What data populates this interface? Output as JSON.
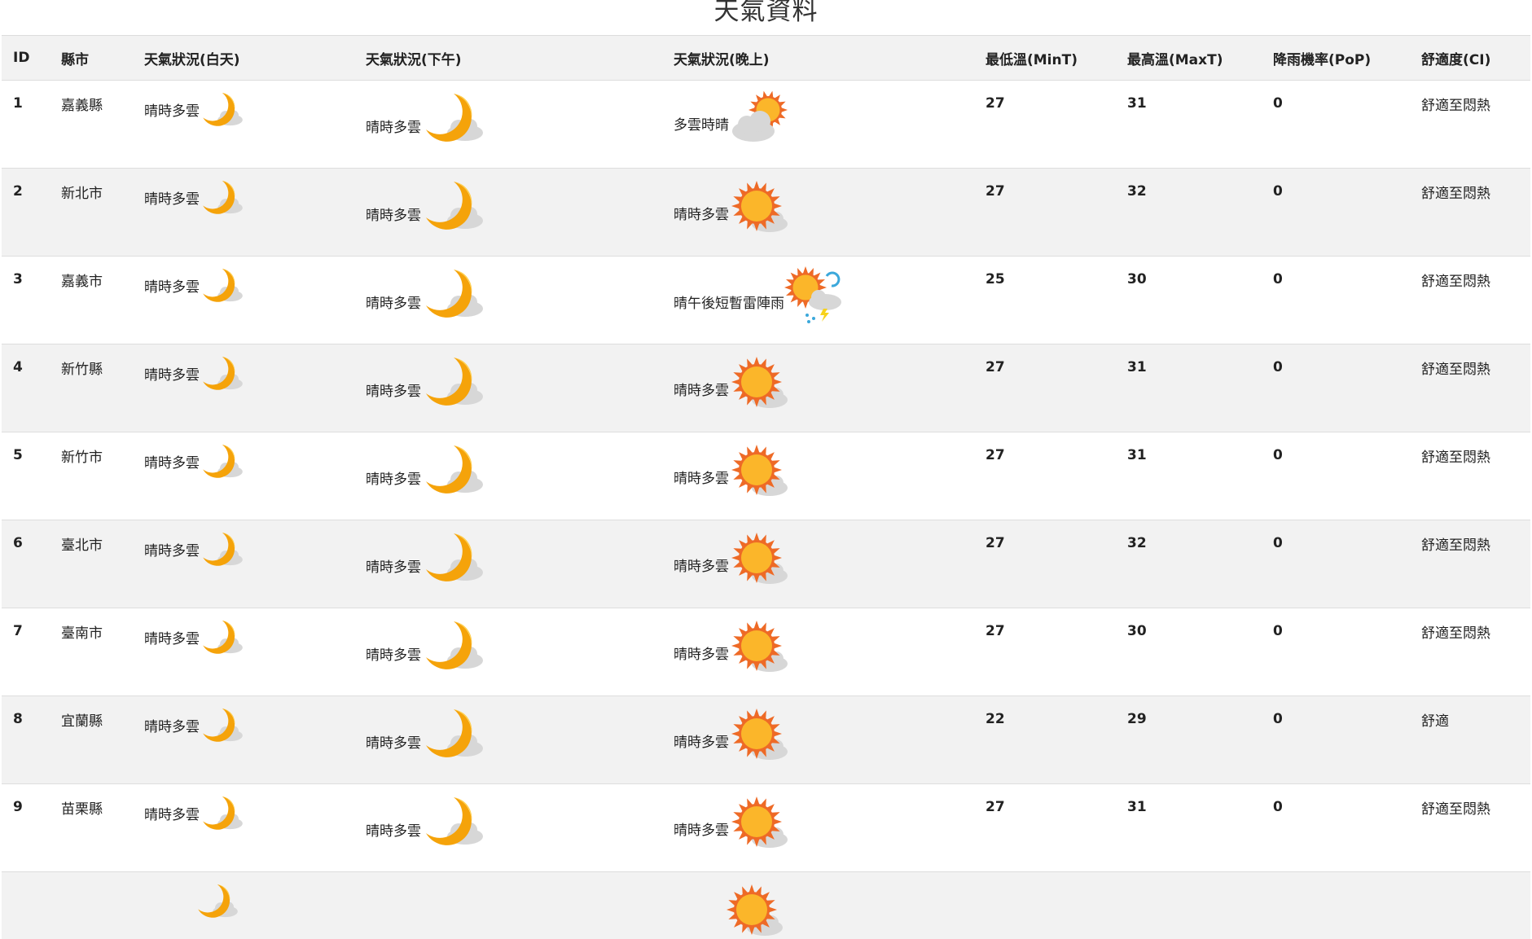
{
  "page_title": "天氣資料",
  "columns": {
    "id": "ID",
    "city": "縣市",
    "wx_day": "天氣狀況(白天)",
    "wx_afternoon": "天氣狀況(下午)",
    "wx_night": "天氣狀況(晚上)",
    "min_t": "最低溫(MinT)",
    "max_t": "最高溫(MaxT)",
    "pop": "降雨機率(PoP)",
    "ci": "舒適度(CI)"
  },
  "rows": [
    {
      "id": "1",
      "city": "嘉義縣",
      "wx_day": "晴時多雲",
      "wx_afternoon": "晴時多雲",
      "wx_night": "多雲時晴",
      "min_t": "27",
      "max_t": "31",
      "pop": "0",
      "ci": "舒適至悶熱",
      "icon_day": "moon-cloud-icon",
      "icon_afternoon": "moon-cloud-icon",
      "icon_night": "cloud-sun-icon"
    },
    {
      "id": "2",
      "city": "新北市",
      "wx_day": "晴時多雲",
      "wx_afternoon": "晴時多雲",
      "wx_night": "晴時多雲",
      "min_t": "27",
      "max_t": "32",
      "pop": "0",
      "ci": "舒適至悶熱",
      "icon_day": "moon-cloud-icon",
      "icon_afternoon": "moon-cloud-icon",
      "icon_night": "sun-cloud-icon"
    },
    {
      "id": "3",
      "city": "嘉義市",
      "wx_day": "晴時多雲",
      "wx_afternoon": "晴時多雲",
      "wx_night": "晴午後短暫雷陣雨",
      "min_t": "25",
      "max_t": "30",
      "pop": "0",
      "ci": "舒適至悶熱",
      "icon_day": "moon-cloud-icon",
      "icon_afternoon": "moon-cloud-icon",
      "icon_night": "sun-thunderstorm-icon"
    },
    {
      "id": "4",
      "city": "新竹縣",
      "wx_day": "晴時多雲",
      "wx_afternoon": "晴時多雲",
      "wx_night": "晴時多雲",
      "min_t": "27",
      "max_t": "31",
      "pop": "0",
      "ci": "舒適至悶熱",
      "icon_day": "moon-cloud-icon",
      "icon_afternoon": "moon-cloud-icon",
      "icon_night": "sun-cloud-icon"
    },
    {
      "id": "5",
      "city": "新竹市",
      "wx_day": "晴時多雲",
      "wx_afternoon": "晴時多雲",
      "wx_night": "晴時多雲",
      "min_t": "27",
      "max_t": "31",
      "pop": "0",
      "ci": "舒適至悶熱",
      "icon_day": "moon-cloud-icon",
      "icon_afternoon": "moon-cloud-icon",
      "icon_night": "sun-cloud-icon"
    },
    {
      "id": "6",
      "city": "臺北市",
      "wx_day": "晴時多雲",
      "wx_afternoon": "晴時多雲",
      "wx_night": "晴時多雲",
      "min_t": "27",
      "max_t": "32",
      "pop": "0",
      "ci": "舒適至悶熱",
      "icon_day": "moon-cloud-icon",
      "icon_afternoon": "moon-cloud-icon",
      "icon_night": "sun-cloud-icon"
    },
    {
      "id": "7",
      "city": "臺南市",
      "wx_day": "晴時多雲",
      "wx_afternoon": "晴時多雲",
      "wx_night": "晴時多雲",
      "min_t": "27",
      "max_t": "30",
      "pop": "0",
      "ci": "舒適至悶熱",
      "icon_day": "moon-cloud-icon",
      "icon_afternoon": "moon-cloud-icon",
      "icon_night": "sun-cloud-icon"
    },
    {
      "id": "8",
      "city": "宜蘭縣",
      "wx_day": "晴時多雲",
      "wx_afternoon": "晴時多雲",
      "wx_night": "晴時多雲",
      "min_t": "22",
      "max_t": "29",
      "pop": "0",
      "ci": "舒適",
      "icon_day": "moon-cloud-icon",
      "icon_afternoon": "moon-cloud-icon",
      "icon_night": "sun-cloud-icon"
    },
    {
      "id": "9",
      "city": "苗栗縣",
      "wx_day": "晴時多雲",
      "wx_afternoon": "晴時多雲",
      "wx_night": "晴時多雲",
      "min_t": "27",
      "max_t": "31",
      "pop": "0",
      "ci": "舒適至悶熱",
      "icon_day": "moon-cloud-icon",
      "icon_afternoon": "moon-cloud-icon",
      "icon_night": "sun-cloud-icon"
    }
  ],
  "partial_row": {
    "icon_day": "moon-cloud-icon",
    "icon_night": "sun-cloud-icon"
  },
  "colors": {
    "header_bg": "#f2f2f2",
    "stripe_bg": "#f2f2f2",
    "border": "#dddddd",
    "moon": "#f5a30a",
    "sun": "#fbb62a",
    "sun_rays": "#ee6a26",
    "cloud": "#d7d7d7",
    "rain": "#3ba8db"
  }
}
